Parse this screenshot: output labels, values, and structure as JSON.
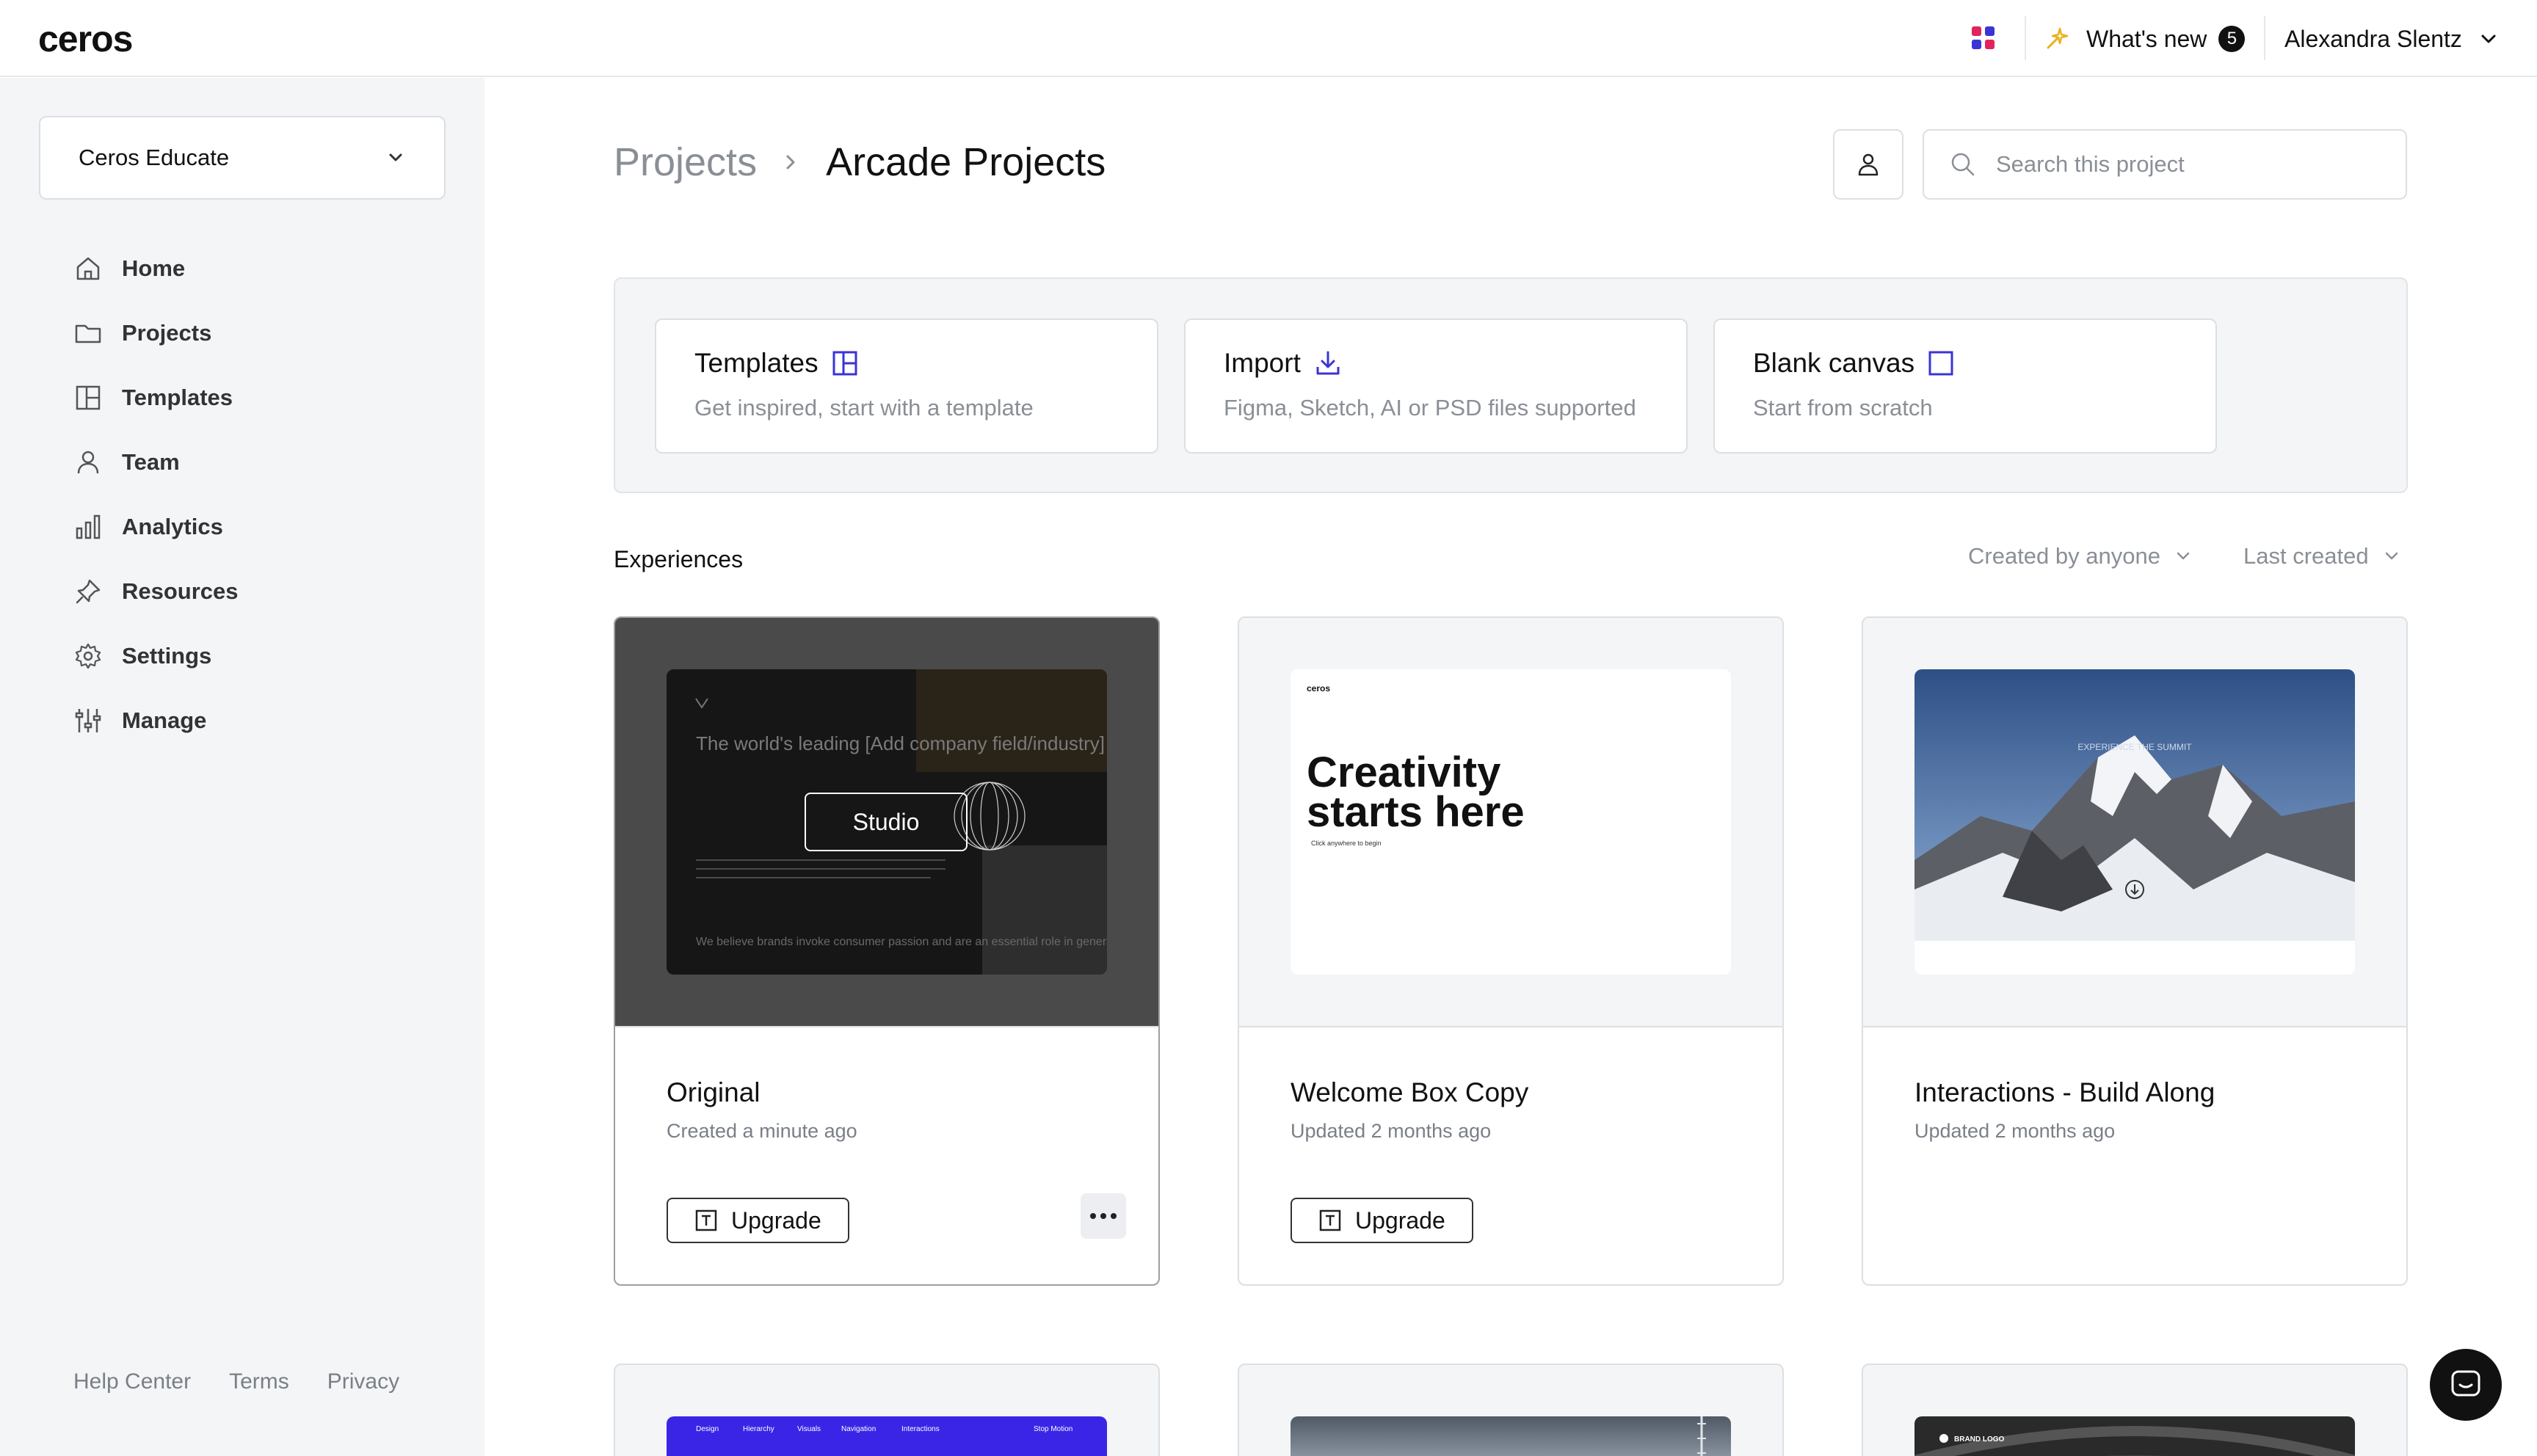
{
  "app": {
    "logo": "ceros"
  },
  "topbar": {
    "whats_new_label": "What's new",
    "whats_new_count": "5",
    "user_name": "Alexandra Slentz"
  },
  "sidebar": {
    "workspace": "Ceros Educate",
    "items": [
      {
        "label": "Home",
        "icon": "home-icon"
      },
      {
        "label": "Projects",
        "icon": "folder-icon"
      },
      {
        "label": "Templates",
        "icon": "templates-icon"
      },
      {
        "label": "Team",
        "icon": "user-icon"
      },
      {
        "label": "Analytics",
        "icon": "bar-chart-icon"
      },
      {
        "label": "Resources",
        "icon": "pin-icon"
      },
      {
        "label": "Settings",
        "icon": "gear-icon"
      },
      {
        "label": "Manage",
        "icon": "sliders-icon"
      }
    ],
    "footer": {
      "help": "Help Center",
      "terms": "Terms",
      "privacy": "Privacy"
    }
  },
  "header": {
    "breadcrumb_parent": "Projects",
    "breadcrumb_current": "Arcade Projects",
    "search_placeholder": "Search this project"
  },
  "create": {
    "templates": {
      "title": "Templates",
      "subtitle": "Get inspired, start with a template"
    },
    "import": {
      "title": "Import",
      "subtitle": "Figma, Sketch, AI or PSD files supported"
    },
    "blank": {
      "title": "Blank canvas",
      "subtitle": "Start from scratch"
    }
  },
  "experiences": {
    "title": "Experiences",
    "filter_creator": "Created by anyone",
    "filter_sort": "Last created",
    "cards": [
      {
        "title": "Original",
        "meta": "Created a minute ago",
        "upgrade_label": "Upgrade",
        "hover_action": "Studio",
        "thumb_text": "The world's leading [Add company field/industry]",
        "thumb_text2": "We believe brands invoke consumer passion and are an essential role in generating growth,"
      },
      {
        "title": "Welcome Box Copy",
        "meta": "Updated 2 months ago",
        "upgrade_label": "Upgrade",
        "thumb_logo": "ceros",
        "thumb_headline_1": "Creativity",
        "thumb_headline_2": "starts here",
        "thumb_caption": "Click anywhere to begin"
      },
      {
        "title": "Interactions - Build Along",
        "meta": "Updated 2 months ago",
        "thumb_caption": "EXPERIENCE THE SUMMIT"
      }
    ],
    "bottom_row": [
      {
        "nav": [
          "Design",
          "Hierarchy",
          "Visuals",
          "Navigation",
          "Interactions",
          "Stop Motion"
        ]
      },
      {},
      {
        "brand": "BRAND LOGO"
      }
    ]
  },
  "colors": {
    "accent": "#3b34d4",
    "sidebar_bg": "#f4f5f7",
    "border": "#dcdfe3",
    "muted_text": "#8a8f96"
  }
}
